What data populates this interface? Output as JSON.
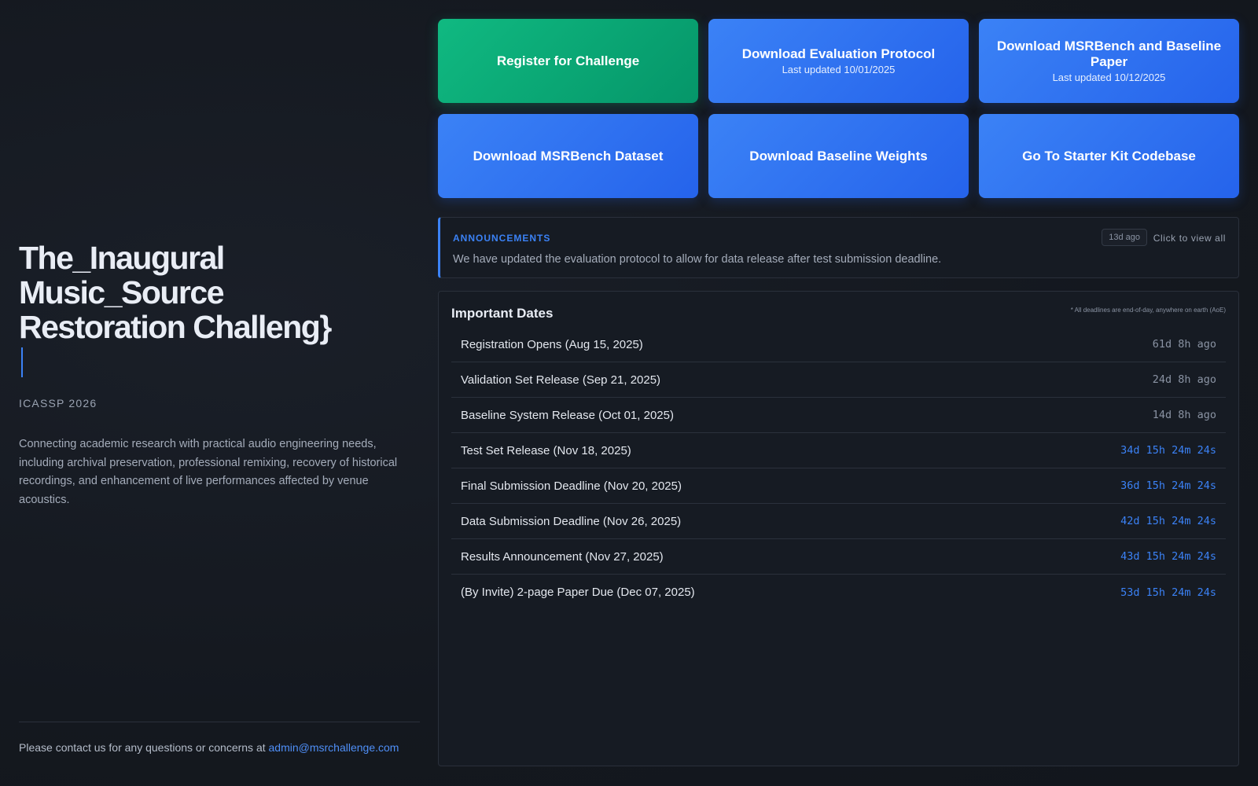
{
  "left": {
    "title": "The_Inaugural Music_Source Restoration Challeng}",
    "subtitle": "ICASSP 2026",
    "description": "Connecting academic research with practical audio engineering needs, including archival preservation, professional remixing, recovery of historical recordings, and enhancement of live performances affected by venue acoustics.",
    "contact_text": "Please contact us for any questions or concerns at ",
    "contact_email": "admin@msrchallenge.com"
  },
  "buttons": [
    {
      "label": "Register for Challenge",
      "updated": "",
      "color": "#10b981"
    },
    {
      "label": "Download Evaluation Protocol",
      "updated": "Last updated 10/01/2025",
      "color": "#3b82f6"
    },
    {
      "label": "Download MSRBench and Baseline Paper",
      "updated": "Last updated 10/12/2025",
      "color": "#3b82f6"
    },
    {
      "label": "Download MSRBench Dataset",
      "updated": "",
      "color": "#3b82f6"
    },
    {
      "label": "Download Baseline Weights",
      "updated": "",
      "color": "#3b82f6"
    },
    {
      "label": "Go To Starter Kit Codebase",
      "updated": "",
      "color": "#3b82f6"
    }
  ],
  "announcements": {
    "heading": "ANNOUNCEMENTS",
    "message": "We have updated the evaluation protocol to allow for data release after test submission deadline.",
    "age": "13d ago",
    "view_all": "Click to view all"
  },
  "important_dates": {
    "title": "Important Dates",
    "note": "* All deadlines are end-of-day, anywhere on earth (AoE)",
    "rows": [
      {
        "event": "Registration Opens (Aug 15, 2025)",
        "countdown": "61d 8h ago",
        "status": "past"
      },
      {
        "event": "Validation Set Release (Sep 21, 2025)",
        "countdown": "24d 8h ago",
        "status": "past"
      },
      {
        "event": "Baseline System Release (Oct 01, 2025)",
        "countdown": "14d 8h ago",
        "status": "past"
      },
      {
        "event": "Test Set Release (Nov 18, 2025)",
        "countdown": "34d 15h 24m 24s",
        "status": "future"
      },
      {
        "event": "Final Submission Deadline (Nov 20, 2025)",
        "countdown": "36d 15h 24m 24s",
        "status": "future"
      },
      {
        "event": "Data Submission Deadline (Nov 26, 2025)",
        "countdown": "42d 15h 24m 24s",
        "status": "future"
      },
      {
        "event": "Results Announcement (Nov 27, 2025)",
        "countdown": "43d 15h 24m 24s",
        "status": "future"
      },
      {
        "event": "(By Invite) 2-page Paper Due (Dec 07, 2025)",
        "countdown": "53d 15h 24m 24s",
        "status": "future"
      }
    ]
  }
}
